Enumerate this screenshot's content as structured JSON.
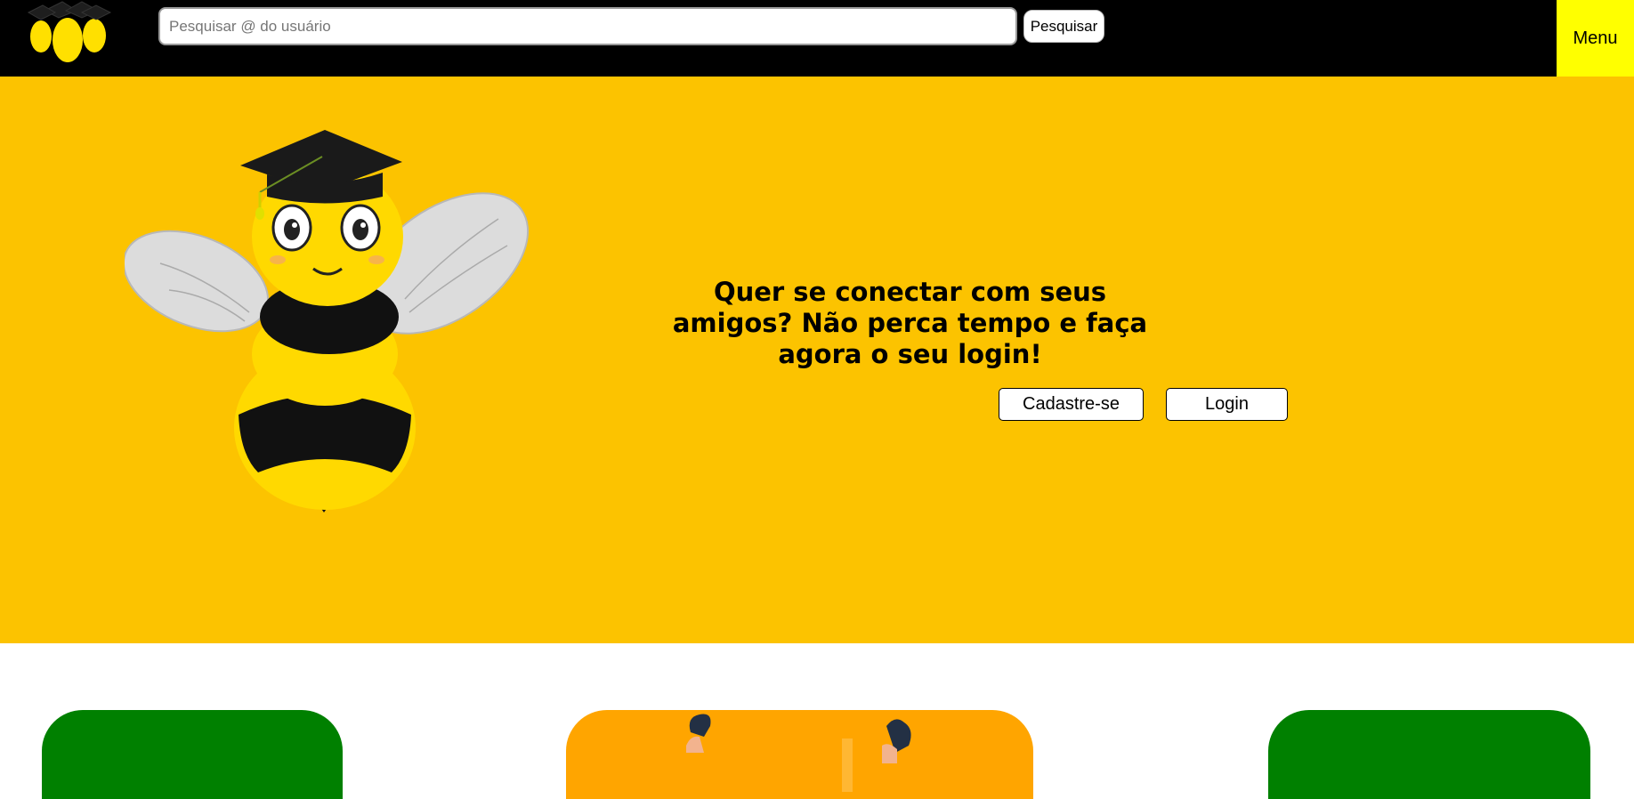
{
  "header": {
    "search": {
      "placeholder": "Pesquisar @ do usuário",
      "value": ""
    },
    "search_button_label": "Pesquisar",
    "menu_label": "Menu",
    "logo_icon": "bee-cluster-logo"
  },
  "hero": {
    "illustration": "graduate-bee",
    "heading": "Quer se conectar com seus amigos? Não perca tempo e faça agora o seu login!",
    "signup_label": "Cadastre-se",
    "login_label": "Login"
  },
  "colors": {
    "topbar": "#000000",
    "menu": "#ffff00",
    "hero": "#fcc300",
    "card_green": "#008000",
    "card_orange": "#ffa500"
  }
}
